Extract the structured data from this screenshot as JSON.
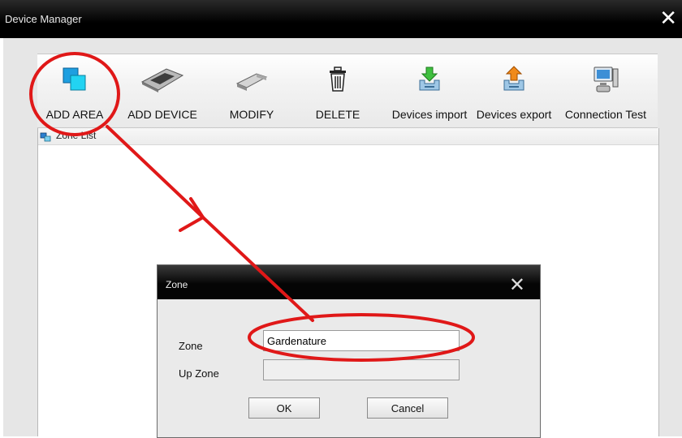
{
  "window": {
    "title": "Device Manager",
    "close_glyph": "✕"
  },
  "toolbar": {
    "buttons": [
      {
        "label": "ADD AREA",
        "icon": "add-area-icon"
      },
      {
        "label": "ADD DEVICE",
        "icon": "add-device-icon"
      },
      {
        "label": "MODIFY",
        "icon": "modify-icon"
      },
      {
        "label": "DELETE",
        "icon": "trash-icon"
      },
      {
        "label": "Devices import",
        "icon": "import-icon"
      },
      {
        "label": "Devices export",
        "icon": "export-icon"
      },
      {
        "label": "Connection Test",
        "icon": "connection-test-icon"
      }
    ]
  },
  "zone_list": {
    "label": "Zone List"
  },
  "dialog": {
    "title": "Zone",
    "close_glyph": "✕",
    "zone_label": "Zone",
    "zone_value": "Gardenature",
    "up_zone_label": "Up Zone",
    "up_zone_value": "",
    "ok_label": "OK",
    "cancel_label": "Cancel"
  },
  "annotation": {
    "color": "#e01818"
  }
}
